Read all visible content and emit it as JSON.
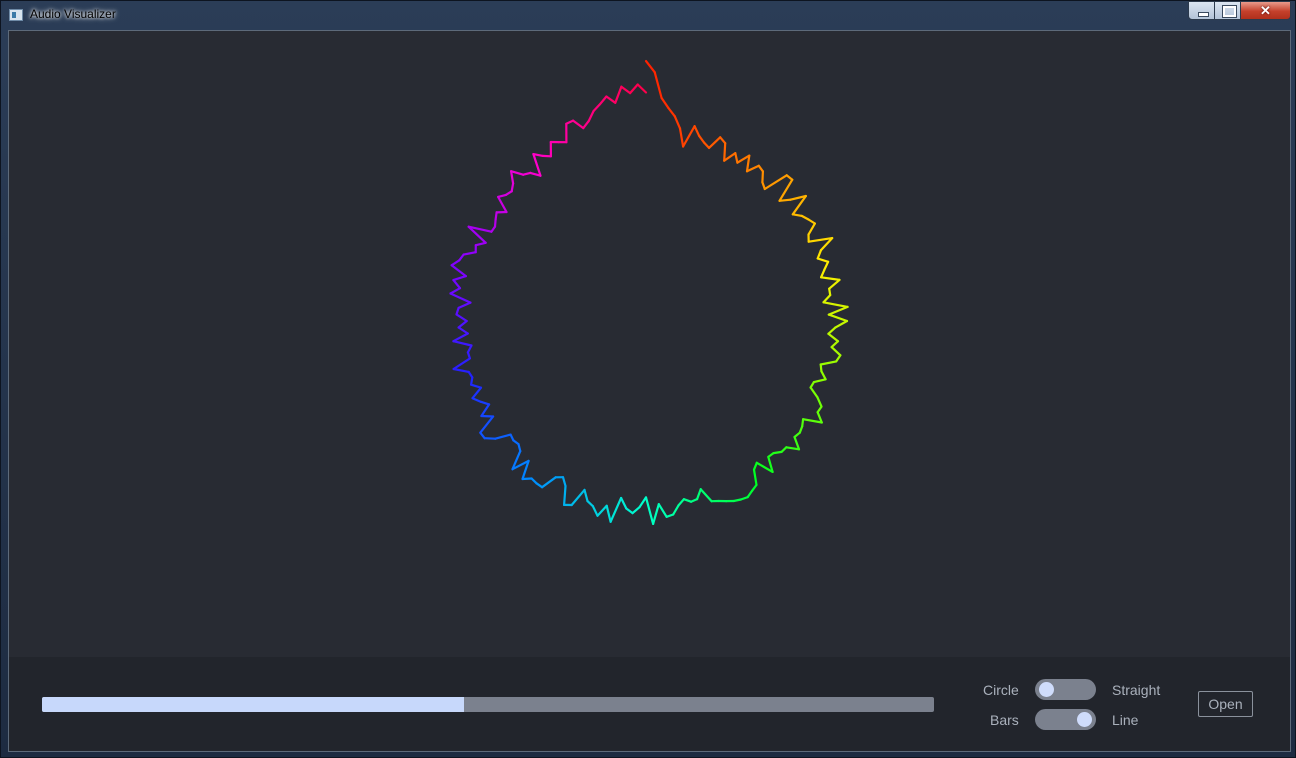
{
  "window": {
    "title": "Audio Visualizer",
    "close_glyph": "✕"
  },
  "controls": {
    "progress_fraction": 0.473,
    "mode_toggle": {
      "left_label": "Circle",
      "right_label": "Straight",
      "state": "Circle"
    },
    "style_toggle": {
      "left_label": "Bars",
      "right_label": "Line",
      "state": "Line"
    },
    "open_label": "Open"
  },
  "visualizer": {
    "style": "line",
    "shape": "circle",
    "colors": [
      "#ff2200",
      "#ff8800",
      "#ffee00",
      "#88ff00",
      "#00ff22",
      "#00ffcc",
      "#0088ff",
      "#2222ff",
      "#8800ff",
      "#ff00cc",
      "#ff0044"
    ]
  },
  "theme": {
    "background": "#282b33",
    "panel": "#22252c",
    "accent": "#c7d8fb"
  }
}
